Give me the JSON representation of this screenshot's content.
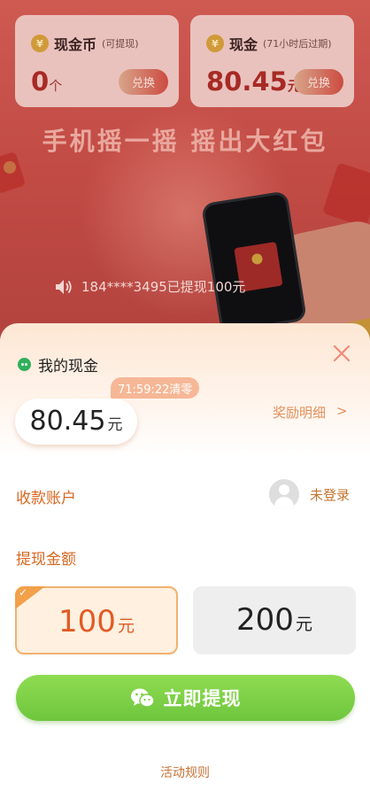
{
  "cards": [
    {
      "title": "现金币",
      "subtitle": "(可提现)",
      "value": "0",
      "unit": "个",
      "button": "兑换"
    },
    {
      "title": "现金",
      "subtitle": "(71小时后过期)",
      "value": "80.45",
      "unit": "元",
      "button": "兑换"
    }
  ],
  "slogan": "手机摇一摇  摇出大红包",
  "ticker": "184****3495已提现100元",
  "sheet": {
    "wallet_title": "我的现金",
    "countdown": "71:59:22清零",
    "amount": "80.45",
    "amount_unit": "元",
    "reward_link": "奖励明细",
    "reward_arrow": ">",
    "account_label": "收款账户",
    "account_status": "未登录",
    "amount_label": "提现金额",
    "options": [
      {
        "value": "100",
        "unit": "元",
        "selected": true
      },
      {
        "value": "200",
        "unit": "元",
        "selected": false
      }
    ],
    "withdraw_button": "立即提现",
    "rules_link": "活动规则"
  },
  "colors": {
    "accent_orange": "#d7671f",
    "selected_amount": "#e35a24",
    "button_green": "#7ccf45",
    "close_icon": "#f08a78"
  },
  "icons": [
    "yen-coin-icon",
    "speaker-icon",
    "wechat-icon",
    "close-icon",
    "avatar-placeholder-icon",
    "check-icon",
    "wechat-pay-icon"
  ]
}
